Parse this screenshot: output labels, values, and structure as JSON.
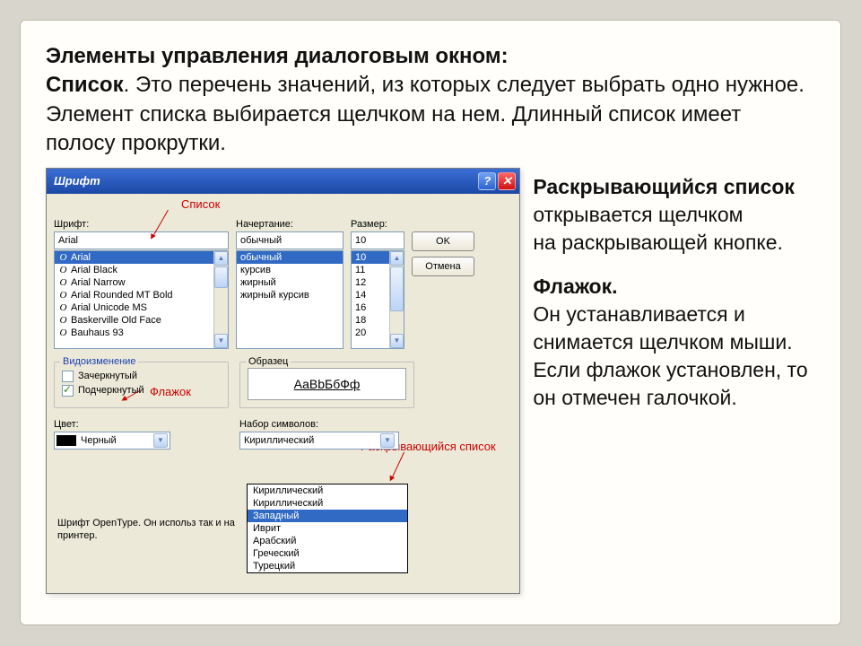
{
  "headline": {
    "title_bold": "Элементы управления диалоговым окном:",
    "list_bold": "Список",
    "list_rest": ". Это перечень значений, из которых следует выбрать одно нужное. Элемент списка выбирается щелчком на нем. Длинный список имеет полосу прокрутки."
  },
  "right_text": {
    "p1_bold": "Раскрывающийся список",
    "p1_rest": " открывается щелчком",
    "p1_line2": " на раскрывающей кнопке.",
    "p2_bold": "Флажок.",
    "p2_rest": "Он устанавливается и снимается щелчком мыши. Если флажок установлен, то он отмечен галочкой."
  },
  "dialog": {
    "title": "Шрифт",
    "font_label": "Шрифт:",
    "style_label": "Начертание:",
    "size_label": "Размер:",
    "font_value": "Arial",
    "style_value": "обычный",
    "size_value": "10",
    "font_list": [
      "Arial",
      "Arial Black",
      "Arial Narrow",
      "Arial Rounded MT Bold",
      "Arial Unicode MS",
      "Baskerville Old Face",
      "Bauhaus 93"
    ],
    "style_list": [
      "обычный",
      "курсив",
      "жирный",
      "жирный курсив"
    ],
    "size_list": [
      "10",
      "11",
      "12",
      "14",
      "16",
      "18",
      "20"
    ],
    "ok": "OK",
    "cancel": "Отмена",
    "effects_legend": "Видоизменение",
    "strike": "Зачеркнутый",
    "underline": "Подчеркнутый",
    "sample_legend": "Образец",
    "sample_text": "АаBbБбФф",
    "color_label": "Цвет:",
    "color_value": "Черный",
    "charset_label": "Набор символов:",
    "charset_value": "Кириллический",
    "charset_list": [
      "Кириллический",
      "Кириллический",
      "Западный",
      "Иврит",
      "Арабский",
      "Греческий",
      "Турецкий"
    ],
    "charset_selected_index": 2,
    "footnote": "Шрифт OpenType. Он использ\nтак и на принтер."
  },
  "callouts": {
    "list": "Список",
    "checkbox": "Флажок",
    "dropdown": "Раскрывающийся список"
  }
}
